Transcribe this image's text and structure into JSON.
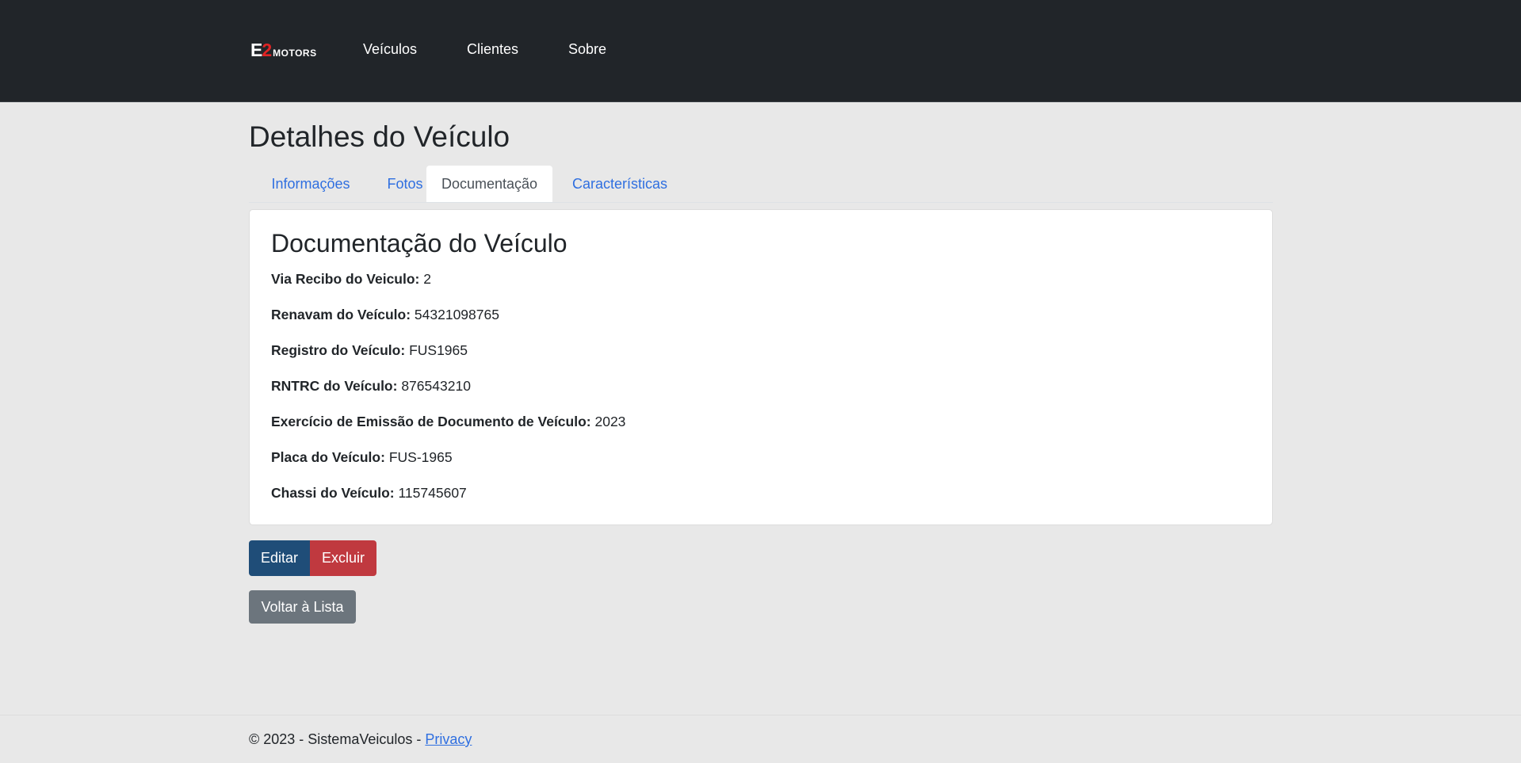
{
  "navbar": {
    "brand": {
      "e": "E",
      "two": "2",
      "motors": "MOTORS"
    },
    "links": [
      "Veículos",
      "Clientes",
      "Sobre"
    ]
  },
  "page": {
    "title": "Detalhes do Veículo",
    "tabs": [
      "Informações",
      "Fotos",
      "Documentação",
      "Características"
    ],
    "active_tab": "Documentação"
  },
  "card": {
    "title": "Documentação do Veículo",
    "fields": [
      {
        "label": "Via Recibo do Veiculo:",
        "value": "2"
      },
      {
        "label": "Renavam do Veículo:",
        "value": "54321098765"
      },
      {
        "label": "Registro do Veículo:",
        "value": "FUS1965"
      },
      {
        "label": "RNTRC do Veículo:",
        "value": "876543210"
      },
      {
        "label": "Exercício de Emissão de Documento de Veículo:",
        "value": "2023"
      },
      {
        "label": "Placa do Veículo:",
        "value": "FUS-1965"
      },
      {
        "label": "Chassi do Veículo:",
        "value": "115745607"
      }
    ]
  },
  "buttons": {
    "edit": "Editar",
    "delete": "Excluir",
    "back": "Voltar à Lista"
  },
  "footer": {
    "text": "© 2023 - SistemaVeiculos - ",
    "privacy": "Privacy"
  },
  "colors": {
    "navbar_bg": "#212529",
    "page_bg": "#e8e8e8",
    "link": "#2f6fe0",
    "edit_button": "#1f4d78",
    "delete_button": "#c0393f",
    "back_button": "#6c757d",
    "brand_accent": "#e02424"
  }
}
